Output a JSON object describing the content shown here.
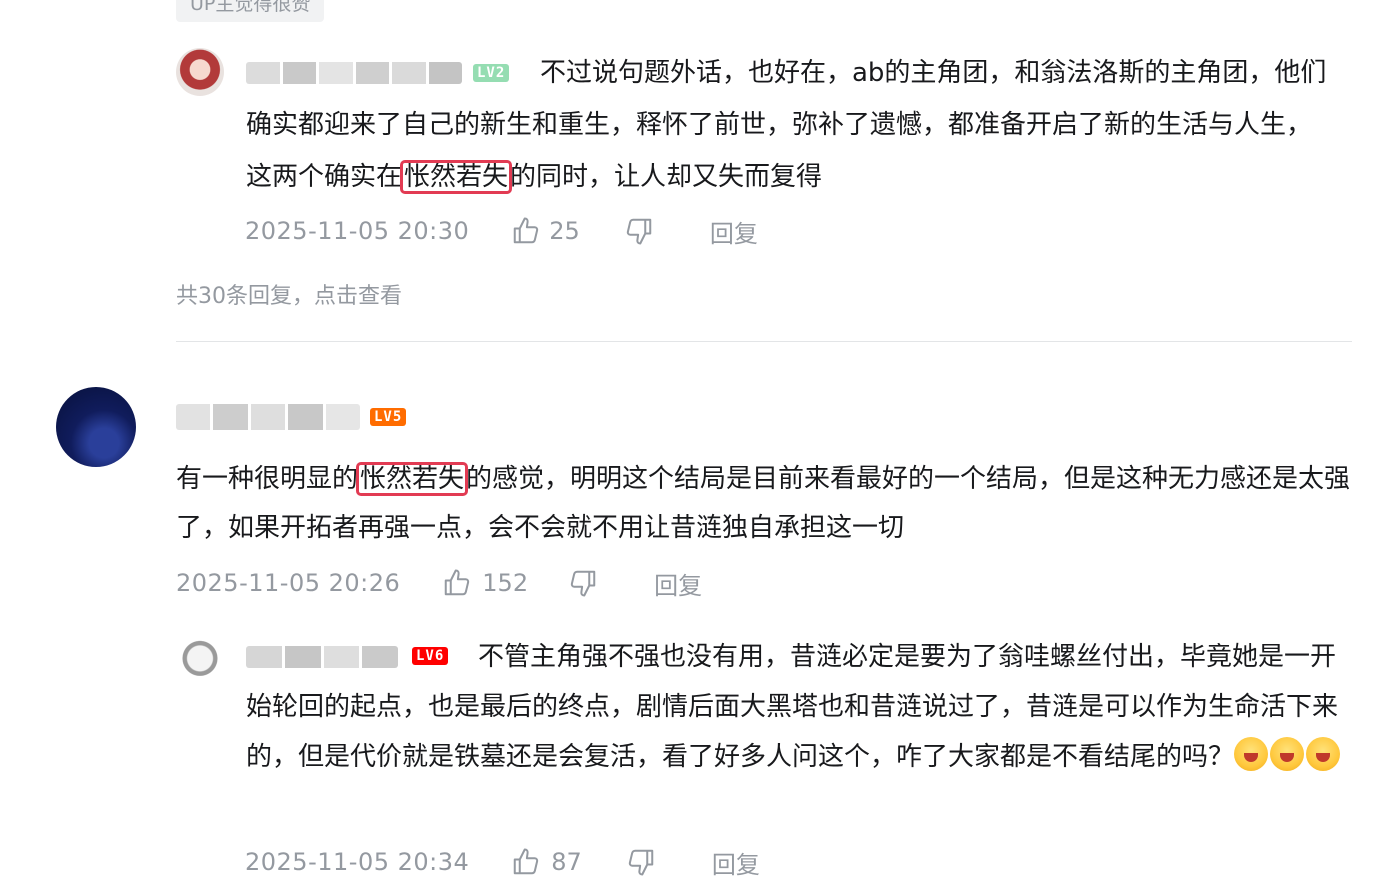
{
  "top_badge": "UP主觉得很赞",
  "colors": {
    "accent_highlight": "#e23b53",
    "meta_gray": "#9499a0",
    "lv2": "#95ddb2",
    "lv5": "#ff6c00",
    "lv6": "#ff0000"
  },
  "comments": [
    {
      "level": "LV2",
      "text_before": "不过说句题外话，也好在，ab的主角团，和翁法洛斯的主角团，他们确实都迎来了自己的新生和重生，释怀了前世，弥补了遗憾，都准备开启了新的生活与人生，这两个确实在",
      "highlight": "怅然若失",
      "text_after": "的同时，让人却又失而复得",
      "date": "2025-11-05 20:30",
      "likes": "25",
      "reply_label": "回复"
    },
    {
      "more_replies": "共30条回复，点击查看"
    },
    {
      "level": "LV5",
      "text_before": "有一种很明显的",
      "highlight": "怅然若失",
      "text_after": "的感觉，明明这个结局是目前来看最好的一个结局，但是这种无力感还是太强了，如果开拓者再强一点，会不会就不用让昔涟独自承担这一切",
      "date": "2025-11-05 20:26",
      "likes": "152",
      "reply_label": "回复"
    },
    {
      "level": "LV6",
      "text": "不管主角强不强也没有用，昔涟必定是要为了翁哇螺丝付出，毕竟她是一开始轮回的起点，也是最后的终点，剧情后面大黑塔也和昔涟说过了，昔涟是可以作为生命活下来的，但是代价就是铁墓还是会复活，看了好多人问这个，咋了大家都是不看结尾的吗？",
      "emoji": "crying-laugh-emoji",
      "date": "2025-11-05 20:34",
      "likes": "87",
      "reply_label": "回复"
    }
  ]
}
